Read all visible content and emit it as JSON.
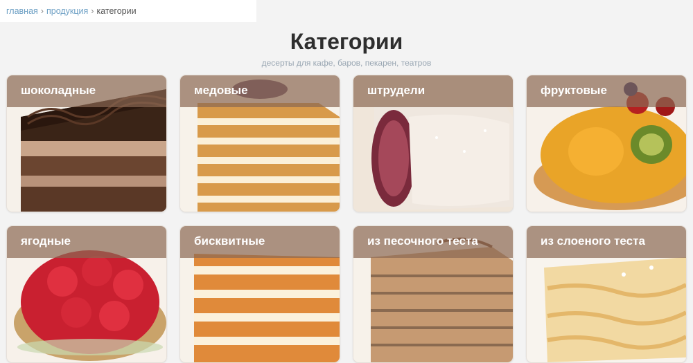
{
  "breadcrumb": {
    "home": "главная",
    "products": "продукция",
    "current": "категории",
    "separator": "›"
  },
  "header": {
    "title": "Категории",
    "subtitle": "десерты для кафе, баров, пекарен, театров"
  },
  "categories": [
    {
      "label": "шоколадные",
      "image": "chocolate-cake-icon"
    },
    {
      "label": "медовые",
      "image": "honey-cake-icon"
    },
    {
      "label": "штрудели",
      "image": "strudel-icon"
    },
    {
      "label": "фруктовые",
      "image": "fruit-tart-icon"
    },
    {
      "label": "ягодные",
      "image": "berry-tart-icon"
    },
    {
      "label": "бисквитные",
      "image": "sponge-cake-icon"
    },
    {
      "label": "из песочного теста",
      "image": "shortcrust-cake-icon"
    },
    {
      "label": "из слоеного теста",
      "image": "puff-pastry-icon"
    }
  ],
  "colors": {
    "page_background": "#f3f3f3",
    "link": "#6c9fc4",
    "title": "#2e2e2e",
    "subtitle": "#9aa7b3",
    "label_overlay": "#8a6852"
  }
}
